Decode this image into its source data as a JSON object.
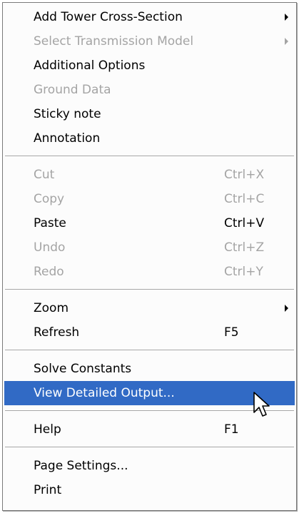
{
  "menu": {
    "items": [
      {
        "label": "Add Tower Cross-Section",
        "shortcut": "",
        "submenu": true,
        "disabled": false
      },
      {
        "label": "Select Transmission Model",
        "shortcut": "",
        "submenu": true,
        "disabled": true
      },
      {
        "label": "Additional Options",
        "shortcut": "",
        "submenu": false,
        "disabled": false
      },
      {
        "label": "Ground Data",
        "shortcut": "",
        "submenu": false,
        "disabled": true
      },
      {
        "label": "Sticky note",
        "shortcut": "",
        "submenu": false,
        "disabled": false
      },
      {
        "label": "Annotation",
        "shortcut": "",
        "submenu": false,
        "disabled": false
      },
      {
        "label": "Cut",
        "shortcut": "Ctrl+X",
        "submenu": false,
        "disabled": true
      },
      {
        "label": "Copy",
        "shortcut": "Ctrl+C",
        "submenu": false,
        "disabled": true
      },
      {
        "label": "Paste",
        "shortcut": "Ctrl+V",
        "submenu": false,
        "disabled": false
      },
      {
        "label": "Undo",
        "shortcut": "Ctrl+Z",
        "submenu": false,
        "disabled": true
      },
      {
        "label": "Redo",
        "shortcut": "Ctrl+Y",
        "submenu": false,
        "disabled": true
      },
      {
        "label": "Zoom",
        "shortcut": "",
        "submenu": true,
        "disabled": false
      },
      {
        "label": "Refresh",
        "shortcut": "F5",
        "submenu": false,
        "disabled": false
      },
      {
        "label": "Solve Constants",
        "shortcut": "",
        "submenu": false,
        "disabled": false
      },
      {
        "label": "View Detailed Output...",
        "shortcut": "",
        "submenu": false,
        "disabled": false,
        "highlighted": true
      },
      {
        "label": "Help",
        "shortcut": "F1",
        "submenu": false,
        "disabled": false
      },
      {
        "label": "Page Settings...",
        "shortcut": "",
        "submenu": false,
        "disabled": false
      },
      {
        "label": "Print",
        "shortcut": "",
        "submenu": false,
        "disabled": false
      }
    ]
  },
  "colors": {
    "highlight": "#316ac5",
    "disabled_text": "#a4a4a4",
    "menu_background": "#fcfcfc"
  },
  "cursor": {
    "icon": "arrow-pointer-icon"
  }
}
